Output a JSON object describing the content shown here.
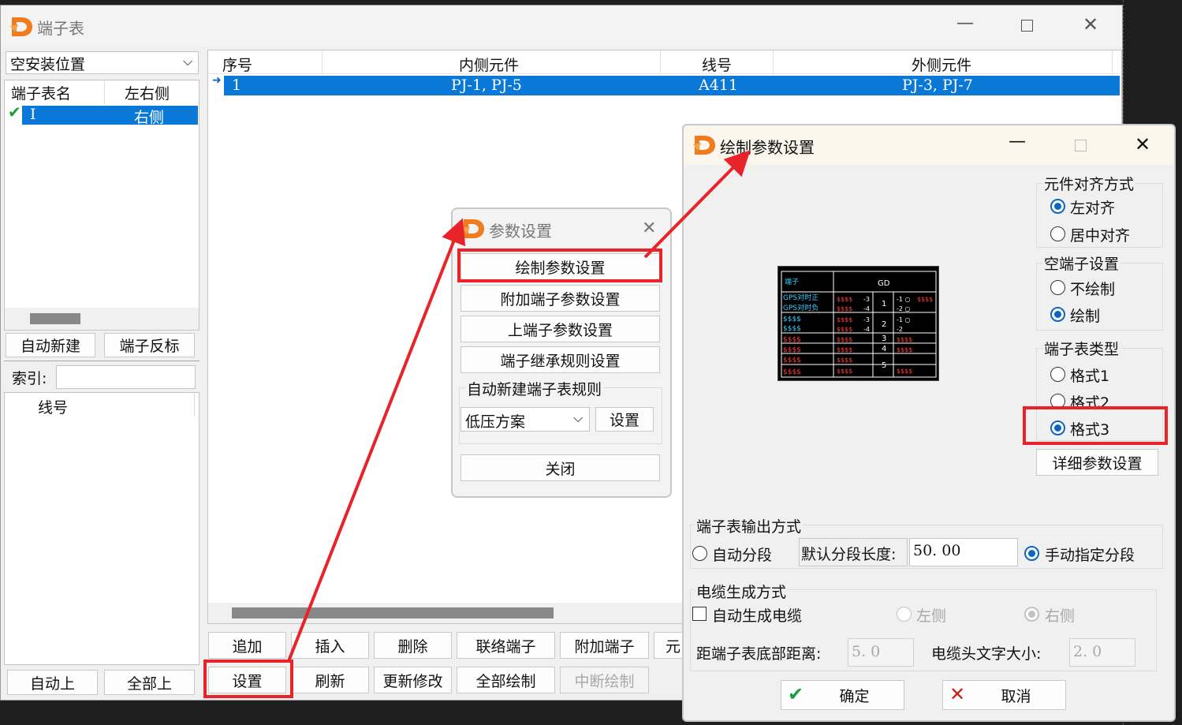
{
  "main_window": {
    "title": "端子表",
    "location_select": "空安装位置",
    "left_list": {
      "headers": [
        "端子表名",
        "左右侧"
      ],
      "rows": [
        {
          "name": "I",
          "side": "右侧"
        }
      ]
    },
    "btn_auto_new": "自动新建",
    "btn_reverse": "端子反标",
    "index_label": "索引:",
    "index_value": "",
    "wire_header": "线号",
    "btn_auto_up": "自动上",
    "btn_all_up": "全部上",
    "table": {
      "headers": [
        "序号",
        "内侧元件",
        "线号",
        "外侧元件"
      ],
      "rows": [
        {
          "no": "1",
          "inner": "PJ-1, PJ-5",
          "wire": "A411",
          "outer": "PJ-3, PJ-7"
        }
      ]
    },
    "toolbar_row1": [
      "追加",
      "插入",
      "删除",
      "联络端子",
      "附加端子",
      "元"
    ],
    "toolbar_row2": [
      "设置",
      "刷新",
      "更新修改",
      "全部绘制",
      "中断绘制"
    ]
  },
  "param_dialog": {
    "title": "参数设置",
    "buttons": [
      "绘制参数设置",
      "附加端子参数设置",
      "上端子参数设置",
      "端子继承规则设置"
    ],
    "group_label": "自动新建端子表规则",
    "scheme_select": "低压方案",
    "set_button": "设置",
    "close_button": "关闭"
  },
  "draw_dialog": {
    "title": "绘制参数设置",
    "align": {
      "label": "元件对齐方式",
      "options": [
        "左对齐",
        "居中对齐"
      ],
      "selected": 0
    },
    "empty": {
      "label": "空端子设置",
      "options": [
        "不绘制",
        "绘制"
      ],
      "selected": 1
    },
    "type": {
      "label": "端子表类型",
      "options": [
        "格式1",
        "格式2",
        "格式3"
      ],
      "selected": 2
    },
    "detail_button": "详细参数设置",
    "output": {
      "label": "端子表输出方式",
      "auto": "自动分段",
      "length_label": "默认分段长度:",
      "length_value": "50. 00",
      "manual": "手动指定分段"
    },
    "cable": {
      "label": "电缆生成方式",
      "auto_cable": "自动生成电缆",
      "left": "左侧",
      "right": "右侧",
      "dist_label": "距端子表底部距离:",
      "dist_value": "5. 0",
      "font_label": "电缆头文字大小:",
      "font_value": "2. 0"
    },
    "ok": "确定",
    "cancel": "取消",
    "preview": {
      "header_left": "端子",
      "header_right": "GD",
      "rows_left": [
        "GPS对时正",
        "GPS对时负",
        "$$$$",
        "$$$$",
        "$$$$",
        "$$$$",
        "$$$$",
        "$$$$"
      ],
      "terminals": [
        "1",
        "2",
        "3",
        "4",
        "5"
      ],
      "pins": [
        "-3",
        "-4",
        "-3",
        "-4"
      ],
      "filler": "$$$$"
    }
  },
  "colors": {
    "accent": "#0a78d7",
    "annotation": "#e8242a",
    "logo": "#f07a1e"
  }
}
